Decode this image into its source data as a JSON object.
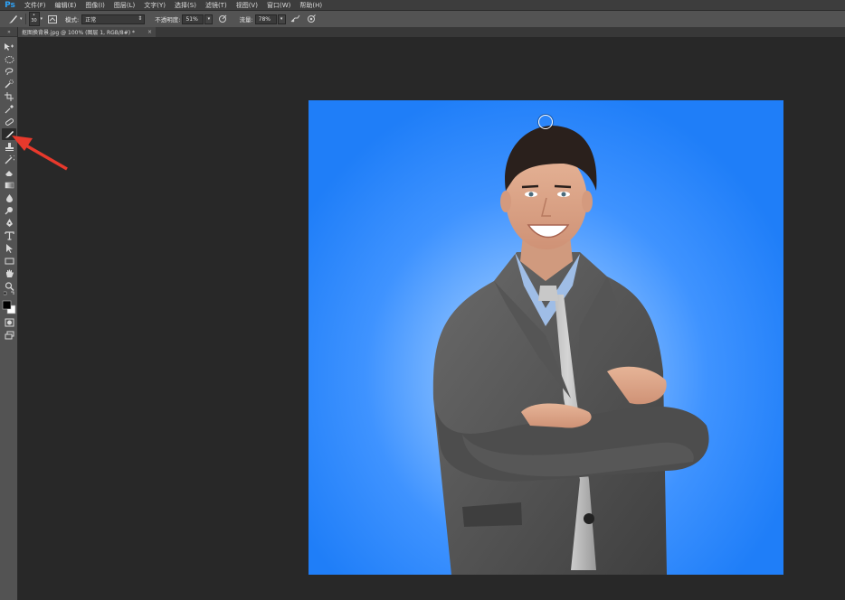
{
  "app": {
    "logo": "Ps",
    "menu": [
      "文件(F)",
      "编辑(E)",
      "图像(I)",
      "图层(L)",
      "文字(Y)",
      "选择(S)",
      "滤镜(T)",
      "视图(V)",
      "窗口(W)",
      "帮助(H)"
    ]
  },
  "options_bar": {
    "brush_size": "30",
    "mode_label": "模式:",
    "mode_value": "正常",
    "opacity_label": "不透明度:",
    "opacity_value": "51%",
    "flow_label": "流量:",
    "flow_value": "78%"
  },
  "document_tab": {
    "title": "抠图换背景.jpg @ 100% (图层 1, RGB/8#) *",
    "close": "×"
  },
  "toolbox": {
    "grip": "»",
    "active_tool": "brush-tool"
  },
  "colors": {
    "background": "#282828",
    "panel": "#535353",
    "menubar": "#3d3d3d",
    "accent": "#2fa3f7",
    "photo_blue": "#1f7ef8",
    "arrow": "#e8392c"
  },
  "icons": [
    "brush-icon",
    "brush-preset-icon",
    "toggle-brush-panel-icon",
    "airbrush-icon",
    "pressure-opacity-icon",
    "pressure-size-icon"
  ]
}
